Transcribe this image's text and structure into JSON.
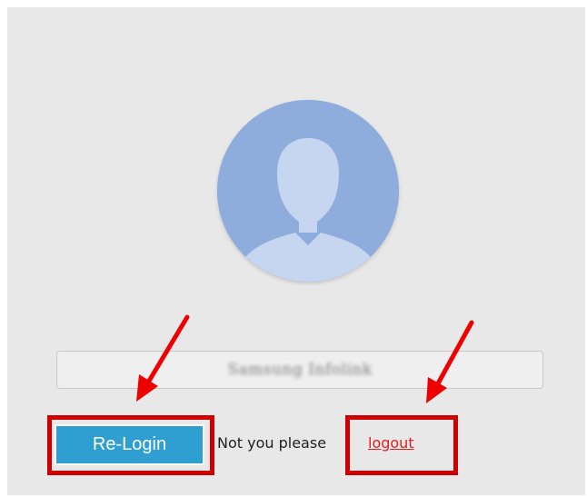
{
  "login": {
    "username_blurred": "Samsung Infolink",
    "relogin_label": "Re-Login",
    "not_you_text": "Not you please",
    "logout_label": "logout"
  },
  "colors": {
    "panel_bg": "#e8e8e8",
    "avatar_bg": "#8eacdc",
    "avatar_silhouette": "#c7d6f0",
    "button_bg": "#2f9fd1",
    "link": "#e02020",
    "annotation": "#cc0000",
    "arrow": "#ee0000"
  },
  "icons": {
    "avatar": "user-silhouette-icon",
    "arrows": "red-arrow-icon"
  }
}
